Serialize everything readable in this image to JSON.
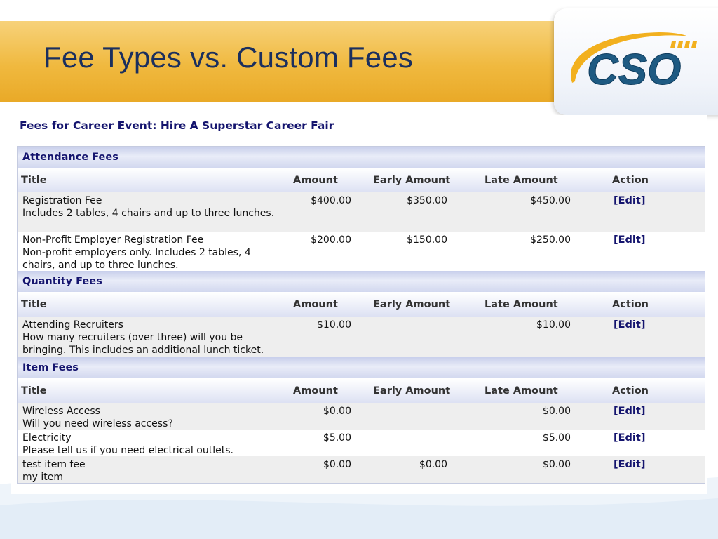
{
  "slide": {
    "title": "Fee Types vs. Custom Fees",
    "logo_text": "CSO"
  },
  "colors": {
    "banner": "#f0b93f",
    "title_text": "#1b2f5e",
    "link": "#14146e",
    "section_header": "#d2d8ef",
    "row_alt": "#eeeeee"
  },
  "page": {
    "heading": "Fees for Career Event: Hire A Superstar Career Fair"
  },
  "columns": {
    "title": "Title",
    "amount": "Amount",
    "early": "Early Amount",
    "late": "Late Amount",
    "action": "Action"
  },
  "sections": [
    {
      "name": "Attendance Fees",
      "rows": [
        {
          "title": "Registration Fee",
          "desc": "Includes 2 tables, 4 chairs and up to three lunches.",
          "amount": "$400.00",
          "early": "$350.00",
          "late": "$450.00",
          "action": "[Edit]"
        },
        {
          "title": "Non-Profit Employer Registration Fee",
          "desc": "Non-profit employers only. Includes 2 tables, 4 chairs, and up to three lunches.",
          "amount": "$200.00",
          "early": "$150.00",
          "late": "$250.00",
          "action": "[Edit]"
        }
      ]
    },
    {
      "name": "Quantity Fees",
      "rows": [
        {
          "title": "Attending Recruiters",
          "desc": "How many recruiters (over three) will you be bringing. This includes an additional lunch ticket.",
          "amount": "$10.00",
          "early": "",
          "late": "$10.00",
          "action": "[Edit]"
        }
      ]
    },
    {
      "name": "Item Fees",
      "rows": [
        {
          "title": "Wireless Access",
          "desc": "Will you need wireless access?",
          "amount": "$0.00",
          "early": "",
          "late": "$0.00",
          "action": "[Edit]"
        },
        {
          "title": "Electricity",
          "desc": "Please tell us if you need electrical outlets.",
          "amount": "$5.00",
          "early": "",
          "late": "$5.00",
          "action": "[Edit]"
        },
        {
          "title": "test item fee",
          "desc": "my item",
          "amount": "$0.00",
          "early": "$0.00",
          "late": "$0.00",
          "action": "[Edit]"
        }
      ]
    }
  ]
}
